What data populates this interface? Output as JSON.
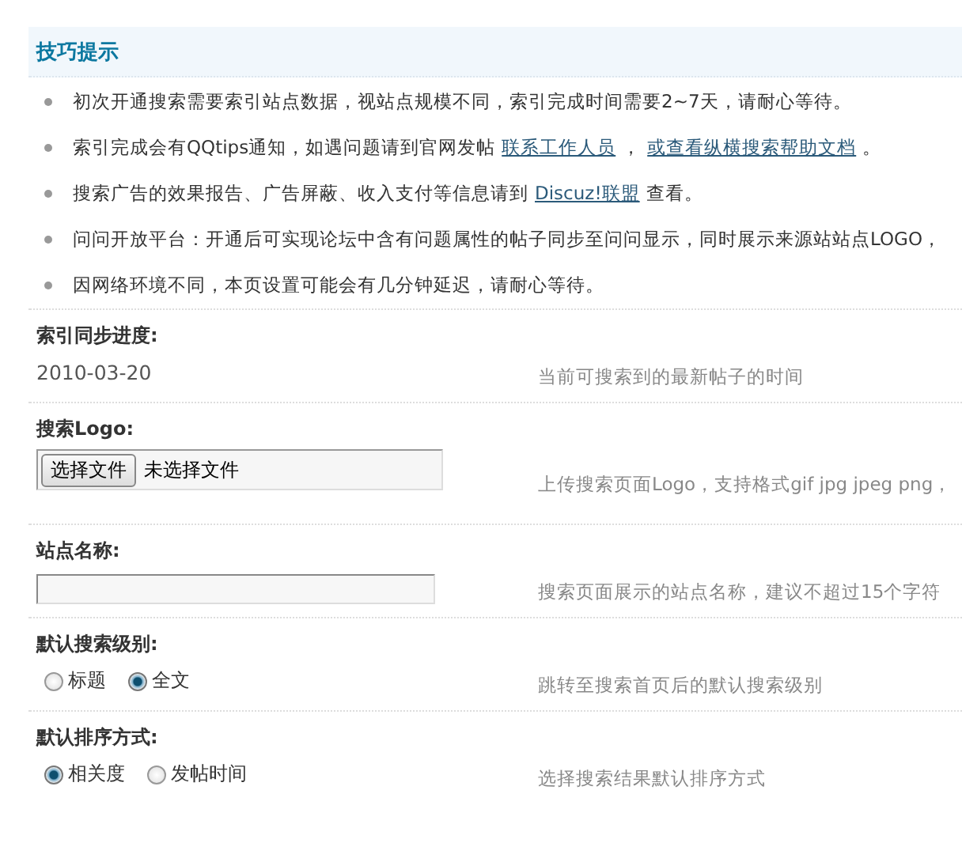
{
  "tips": {
    "title": "技巧提示",
    "items": [
      {
        "text": "初次开通搜索需要索引站点数据，视站点规模不同，索引完成时间需要2~7天，请耐心等待。"
      },
      {
        "text": "索引完成会有QQtips通知，如遇问题请到官网发帖",
        "links": [
          {
            "label": "联系工作人员",
            "after": "，"
          },
          {
            "label": "或查看纵横搜索帮助文档",
            "after": "。"
          }
        ]
      },
      {
        "text": "搜索广告的效果报告、广告屏蔽、收入支付等信息请到",
        "links": [
          {
            "label": "Discuz!联盟",
            "after": "查看。"
          }
        ]
      },
      {
        "text": "问问开放平台：开通后可实现论坛中含有问题属性的帖子同步至问问显示，同时展示来源站站点LOGO，"
      },
      {
        "text": "因网络环境不同，本页设置可能会有几分钟延迟，请耐心等待。"
      }
    ]
  },
  "settings": [
    {
      "kind": "text",
      "label": "索引同步进度:",
      "value": "2010-03-20",
      "description": "当前可搜索到的最新帖子的时间"
    },
    {
      "kind": "file",
      "label": "搜索Logo:",
      "button": "选择文件",
      "status": "未选择文件",
      "description": "上传搜索页面Logo，支持格式gif jpg jpeg png，"
    },
    {
      "kind": "input",
      "label": "站点名称:",
      "description": "搜索页面展示的站点名称，建议不超过15个字符"
    },
    {
      "kind": "radio",
      "label": "默认搜索级别:",
      "options": [
        {
          "label": "标题",
          "selected": false
        },
        {
          "label": "全文",
          "selected": true
        }
      ],
      "description": "跳转至搜索首页后的默认搜索级别"
    },
    {
      "kind": "radio",
      "label": "默认排序方式:",
      "options": [
        {
          "label": "相关度",
          "selected": true
        },
        {
          "label": "发帖时间",
          "selected": false
        }
      ],
      "description": "选择搜索结果默认排序方式"
    }
  ]
}
